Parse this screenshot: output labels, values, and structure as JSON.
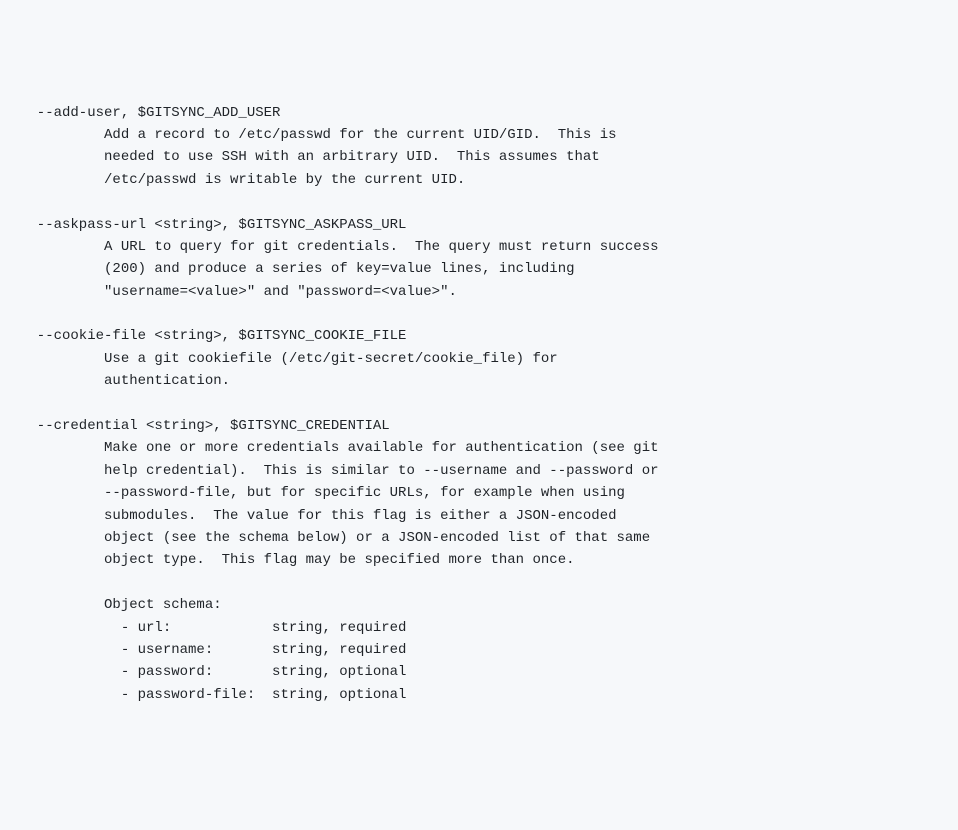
{
  "options": [
    {
      "header": "--add-user, $GITSYNC_ADD_USER",
      "description_lines": [
        "Add a record to /etc/passwd for the current UID/GID.  This is",
        "needed to use SSH with an arbitrary UID.  This assumes that",
        "/etc/passwd is writable by the current UID."
      ]
    },
    {
      "header": "--askpass-url <string>, $GITSYNC_ASKPASS_URL",
      "description_lines": [
        "A URL to query for git credentials.  The query must return success",
        "(200) and produce a series of key=value lines, including",
        "\"username=<value>\" and \"password=<value>\"."
      ]
    },
    {
      "header": "--cookie-file <string>, $GITSYNC_COOKIE_FILE",
      "description_lines": [
        "Use a git cookiefile (/etc/git-secret/cookie_file) for",
        "authentication."
      ]
    },
    {
      "header": "--credential <string>, $GITSYNC_CREDENTIAL",
      "description_lines": [
        "Make one or more credentials available for authentication (see git",
        "help credential).  This is similar to --username and --password or",
        "--password-file, but for specific URLs, for example when using",
        "submodules.  The value for this flag is either a JSON-encoded",
        "object (see the schema below) or a JSON-encoded list of that same",
        "object type.  This flag may be specified more than once.",
        "",
        "Object schema:",
        "  - url:            string, required",
        "  - username:       string, required",
        "  - password:       string, optional",
        "  - password-file:  string, optional"
      ]
    }
  ],
  "indent_header": "  ",
  "indent_desc": "          "
}
